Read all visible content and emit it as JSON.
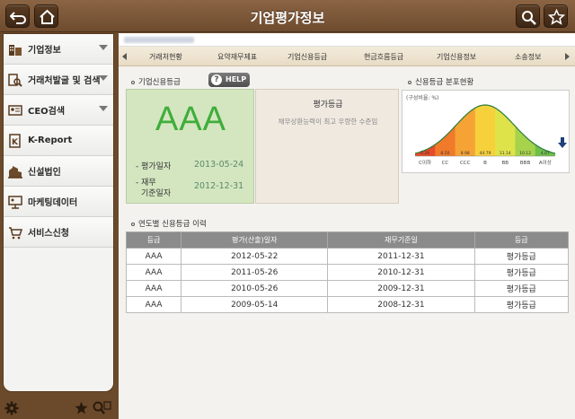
{
  "header": {
    "title": "기업평가정보"
  },
  "sidebar": {
    "items": [
      {
        "label": "기업정보",
        "has_chevron": true,
        "icon": "building-icon"
      },
      {
        "label": "거래처발굴 및 검색",
        "has_chevron": true,
        "icon": "search-document-icon"
      },
      {
        "label": "CEO검색",
        "has_chevron": true,
        "icon": "id-card-icon"
      },
      {
        "label": "K-Report",
        "has_chevron": false,
        "icon": "report-icon"
      },
      {
        "label": "신설법인",
        "has_chevron": false,
        "icon": "new-building-icon"
      },
      {
        "label": "마케팅데이터",
        "has_chevron": false,
        "icon": "presentation-icon"
      },
      {
        "label": "서비스신청",
        "has_chevron": false,
        "icon": "cart-icon"
      }
    ]
  },
  "tabs": [
    "거래처현황",
    "요약재무제표",
    "기업신용등급",
    "현금흐름등급",
    "기업신용정보",
    "소송정보"
  ],
  "active_tab": "기업신용등급",
  "credit": {
    "section_title": "기업신용등급",
    "help_label": "HELP",
    "grade": "AAA",
    "eval_date_label": "평가일자",
    "eval_date": "2013-05-24",
    "fin_date_label_1": "재무",
    "fin_date_label_2": "기준일자",
    "fin_date": "2012-12-31",
    "eval_grade_title": "평가등급",
    "eval_grade_desc": "채무상환능력이 최고 우량한 수준임"
  },
  "distribution": {
    "section_title": "신용등급 분포현황",
    "unit_label": "(구성비율: %)"
  },
  "chart_data": {
    "type": "bar",
    "categories": [
      "C이하",
      "CC",
      "CCC",
      "B",
      "BB",
      "BBB",
      "A이상"
    ],
    "values": [
      0.26,
      8.5,
      8.98,
      44.79,
      11.14,
      10.12,
      4.07
    ],
    "value_labels": [
      "0.26",
      "8.50",
      "8.98",
      "44.79",
      "11.14",
      "10.12",
      "4.07"
    ],
    "colors": [
      "#e84a2a",
      "#f07a2a",
      "#f6a336",
      "#f7d13c",
      "#dfe34a",
      "#a6d24c",
      "#6dbf4a"
    ],
    "title": "",
    "xlabel": "",
    "ylabel": ""
  },
  "history": {
    "section_title": "연도별 신용등급 이력",
    "columns": [
      "등급",
      "평가(산출)일자",
      "재무기준일",
      "등급"
    ],
    "rows": [
      [
        "AAA",
        "2012-05-22",
        "2011-12-31",
        "평가등급"
      ],
      [
        "AAA",
        "2011-05-26",
        "2010-12-31",
        "평가등급"
      ],
      [
        "AAA",
        "2010-05-26",
        "2009-12-31",
        "평가등급"
      ],
      [
        "AAA",
        "2009-05-14",
        "2008-12-31",
        "평가등급"
      ]
    ]
  }
}
